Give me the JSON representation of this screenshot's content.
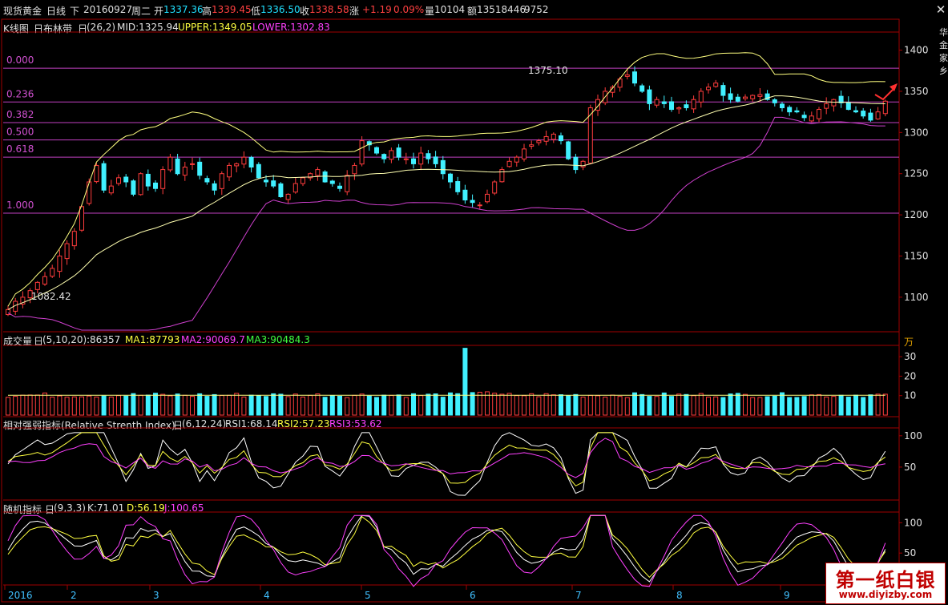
{
  "header": {
    "instrument": "现货黄金",
    "period": "日线",
    "direction": "下",
    "date": "20160927",
    "weekday": "周二",
    "open_label": "开",
    "open": "1337.36",
    "high_label": "高",
    "high": "1339.45",
    "low_label": "低",
    "low": "1336.50",
    "close_label": "收",
    "close": "1338.58",
    "change_label": "涨",
    "change": "+1.19",
    "change_pct": "0.09%",
    "volume_label": "量",
    "volume": "10104",
    "amount_label": "额",
    "amount": "13518446",
    "extra": "9752",
    "close_icon": "close-icon"
  },
  "main_panel": {
    "title_prefix": "K线图",
    "indicator": "日布林带",
    "period_label": "日",
    "params": "(26,2)",
    "mid": "MID:1325.94",
    "upper": "UPPER:1349.05",
    "lower": "LOWER:1302.83",
    "fib_labels": [
      "0.000",
      "0.236",
      "0.382",
      "0.500",
      "0.618",
      "1.000"
    ],
    "fib_levels": [
      1378,
      1337,
      1312,
      1291,
      1270,
      1202
    ],
    "annot_high": "1375.10",
    "annot_low": "1082.42",
    "price_ticks": [
      "1400",
      "1350",
      "1300",
      "1250",
      "1200",
      "1150",
      "1100"
    ],
    "side_text": "华金家乡"
  },
  "volume_panel": {
    "title": "成交量",
    "period_label": "日",
    "params": "(5,10,20)",
    "current": ":86357",
    "ma1": "MA1:87793",
    "ma2": "MA2:90069.7",
    "ma3": "MA3:90484.3",
    "unit": "万",
    "ticks": [
      "30",
      "20",
      "10"
    ]
  },
  "rsi_panel": {
    "title": "相对强弱指标(Relative Strenth Index)",
    "period_label": "日",
    "params": "(6,12,24)",
    "rsi1": "RSI1:68.14",
    "rsi2": "RSI2:57.23",
    "rsi3": "RSI3:53.62",
    "ticks": [
      "100",
      "50"
    ]
  },
  "kdj_panel": {
    "title": "随机指标",
    "period_label": "日",
    "params": "(9,3,3)",
    "k": "K:71.01",
    "d": "D:56.19",
    "j": "J:100.65",
    "ticks": [
      "100",
      "50"
    ]
  },
  "x_axis": {
    "labels": [
      "2016",
      "2",
      "3",
      "4",
      "5",
      "6",
      "7",
      "8",
      "9"
    ]
  },
  "watermark": {
    "big": "第一纸白银",
    "small": "www.diyizby.com"
  },
  "colors": {
    "up": "#ff3c3c",
    "down": "#40f0ff",
    "mid_line": "#ffffb0",
    "boll_band": "#ffff80",
    "lower_band": "#d040d0",
    "fib_line": "#c040c0",
    "grid": "#a00000",
    "axis_text": "#e0e0e0",
    "rsi1": "#ffffff",
    "rsi2": "#ffff40",
    "rsi3": "#ff40ff",
    "kdj_k": "#ffffff",
    "kdj_d": "#ffff40",
    "kdj_j": "#ff40ff"
  },
  "chart_data": {
    "type": "candlestick",
    "title": "现货黄金 日线",
    "x_range": [
      "2016-01",
      "2016-09-27"
    ],
    "ylim": [
      1060,
      1420
    ],
    "months": [
      "2016",
      "2",
      "3",
      "4",
      "5",
      "6",
      "7",
      "8",
      "9"
    ],
    "ohlc_close_path": [
      1085,
      1095,
      1100,
      1108,
      1118,
      1125,
      1135,
      1150,
      1165,
      1180,
      1210,
      1240,
      1260,
      1230,
      1235,
      1245,
      1240,
      1225,
      1250,
      1235,
      1232,
      1255,
      1270,
      1250,
      1258,
      1262,
      1248,
      1240,
      1230,
      1250,
      1260,
      1262,
      1270,
      1258,
      1245,
      1240,
      1235,
      1222,
      1225,
      1238,
      1245,
      1250,
      1255,
      1240,
      1238,
      1232,
      1248,
      1260,
      1290,
      1285,
      1275,
      1268,
      1278,
      1270,
      1268,
      1262,
      1275,
      1268,
      1262,
      1250,
      1240,
      1228,
      1218,
      1215,
      1212,
      1225,
      1240,
      1255,
      1265,
      1270,
      1280,
      1285,
      1290,
      1295,
      1298,
      1290,
      1268,
      1255,
      1265,
      1330,
      1340,
      1350,
      1355,
      1365,
      1370,
      1360,
      1350,
      1335,
      1340,
      1335,
      1328,
      1330,
      1330,
      1340,
      1350,
      1355,
      1360,
      1345,
      1340,
      1338,
      1343,
      1345,
      1346,
      1340,
      1336,
      1330,
      1325,
      1325,
      1318,
      1320,
      1328,
      1335,
      1340,
      1336,
      1328,
      1325,
      1320,
      1315,
      1325,
      1338
    ],
    "bollinger": {
      "mid": "1325.94",
      "upper": "1349.05",
      "lower": "1302.83"
    },
    "volume_unit": "万",
    "rsi": {
      "rsi1": 68.14,
      "rsi2": 57.23,
      "rsi3": 53.62
    },
    "kdj": {
      "k": 71.01,
      "d": 56.19,
      "j": 100.65
    }
  }
}
